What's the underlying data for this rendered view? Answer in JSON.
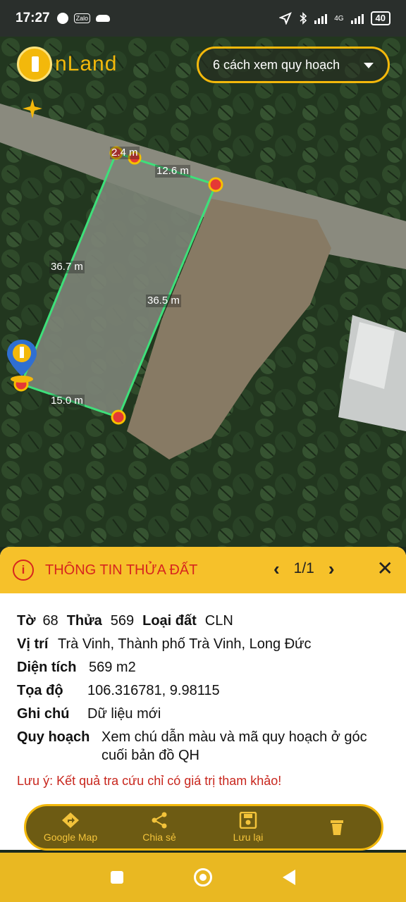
{
  "status_bar": {
    "time": "17:27",
    "zalo": "Zalo",
    "network": "4G",
    "battery": "40"
  },
  "app": {
    "logo_text": "nLand",
    "plan_dropdown_label": "6 cách xem quy hoạch"
  },
  "map": {
    "measurements": {
      "top_short": "2.4 m",
      "top": "12.6 m",
      "left": "36.7 m",
      "right": "36.5 m",
      "bottom": "15.0 m"
    }
  },
  "panel": {
    "title": "THÔNG TIN THỬA ĐẤT",
    "pager": "1/1",
    "to_label": "Tờ",
    "to_value": "68",
    "thua_label": "Thửa",
    "thua_value": "569",
    "loai_dat_label": "Loại đất",
    "loai_dat_value": "CLN",
    "vi_tri_label": "Vị trí",
    "vi_tri_value": "Trà Vinh, Thành phố Trà Vinh, Long Đức",
    "dien_tich_label": "Diện tích",
    "dien_tich_value": "569 m2",
    "toa_do_label": "Tọa độ",
    "toa_do_value": "106.316781, 9.98115",
    "ghi_chu_label": "Ghi chú",
    "ghi_chu_value": "Dữ liệu mới",
    "quy_hoach_label": "Quy hoạch",
    "quy_hoach_value": "Xem chú dẫn màu và mã quy hoạch ở góc cuối bản đồ QH",
    "note": "Lưu ý: Kết quả tra cứu chỉ có giá trị tham khảo!"
  },
  "actions": {
    "google_map": "Google Map",
    "share": "Chia sẻ",
    "save": "Lưu lại"
  },
  "colors": {
    "accent": "#f3b80b",
    "panel_header": "#f6c12a",
    "warning_red": "#d7261e",
    "parcel_outline": "#3ee07a"
  }
}
